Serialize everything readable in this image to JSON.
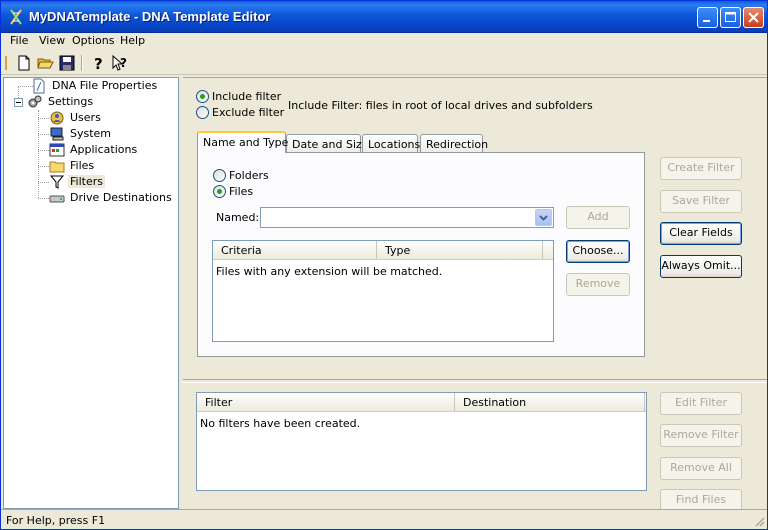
{
  "window": {
    "title": "MyDNATemplate - DNA Template Editor"
  },
  "menu": [
    "File",
    "View",
    "Options",
    "Help"
  ],
  "toolbar": [
    "new-icon",
    "open-icon",
    "save-icon",
    "help-icon",
    "context-help-icon"
  ],
  "tree": {
    "items": [
      {
        "label": "DNA File Properties",
        "icon": "dna-file-icon"
      },
      {
        "label": "Settings",
        "icon": "settings-gears-icon"
      },
      {
        "label": "Users",
        "icon": "users-icon"
      },
      {
        "label": "System",
        "icon": "system-icon"
      },
      {
        "label": "Applications",
        "icon": "applications-icon"
      },
      {
        "label": "Files",
        "icon": "folder-icon"
      },
      {
        "label": "Filters",
        "icon": "filter-icon",
        "selected": true
      },
      {
        "label": "Drive Destinations",
        "icon": "drive-icon"
      }
    ]
  },
  "filter_mode": {
    "include_label": "Include filter",
    "exclude_label": "Exclude filter",
    "selected": "include",
    "description": "Include Filter: files in root of local drives and subfolders"
  },
  "tabs": [
    "Name and Type",
    "Date and Size",
    "Locations",
    "Redirection"
  ],
  "active_tab": "Name and Type",
  "name_type": {
    "folders_label": "Folders",
    "files_label": "Files",
    "selected": "files",
    "named_label": "Named:",
    "named_value": "",
    "criteria_columns": [
      "Criteria",
      "Type"
    ],
    "criteria_empty": "Files with any extension will be matched.",
    "add_button": "Add",
    "choose_button": "Choose...",
    "remove_button": "Remove"
  },
  "side_buttons": {
    "create_filter": "Create Filter",
    "save_filter": "Save Filter",
    "clear_fields": "Clear Fields",
    "always_omit": "Always Omit..."
  },
  "filters_list": {
    "columns": [
      "Filter",
      "Destination"
    ],
    "empty": "No filters have been created."
  },
  "lower_buttons": {
    "edit_filter": "Edit Filter",
    "remove_filter": "Remove Filter",
    "remove_all": "Remove All",
    "find_files": "Find Files"
  },
  "status": "For Help, press F1"
}
